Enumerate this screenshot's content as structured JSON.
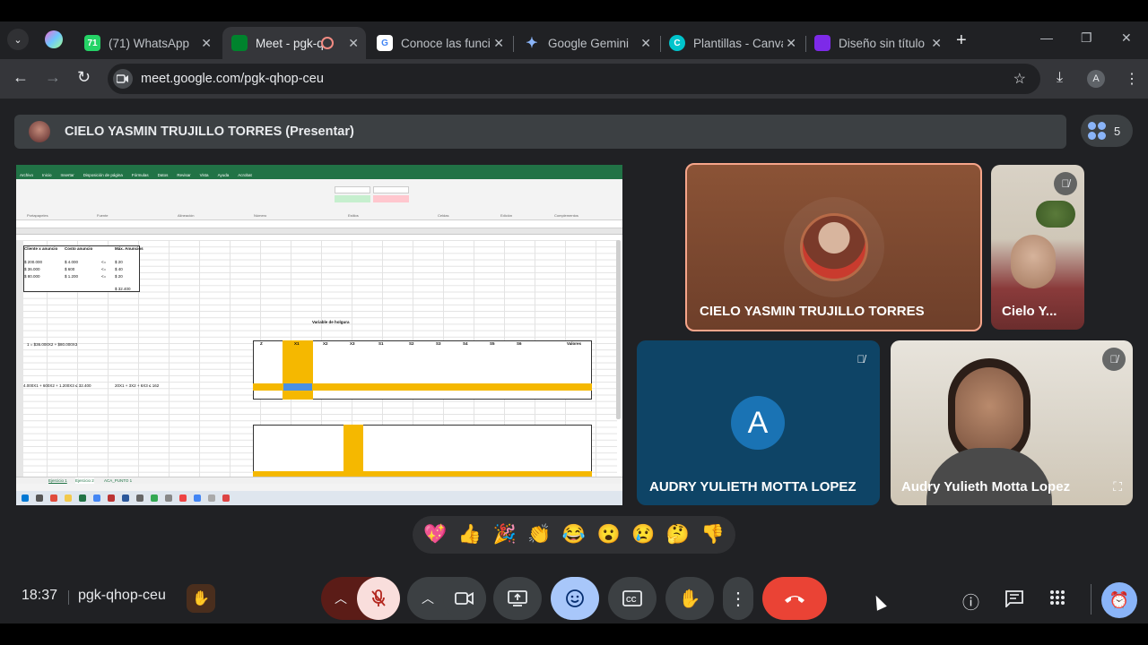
{
  "browser": {
    "tabs": [
      {
        "label": "(71) WhatsApp",
        "badge": "71",
        "fav_color": "#25d366"
      },
      {
        "label": "Meet - pgk-q",
        "fav_color": "#00832d"
      },
      {
        "label": "Conoce las funcio",
        "fav_color": "#ffffff"
      },
      {
        "label": "Google Gemini",
        "fav_color": "#4e8df5"
      },
      {
        "label": "Plantillas - Canva",
        "fav_color": "#00c4cc"
      },
      {
        "label": "Diseño sin título",
        "fav_color": "#7d2ae8"
      }
    ],
    "url": "meet.google.com/pgk-qhop-ceu",
    "profile_initial": "A"
  },
  "meet": {
    "presenter_label": "CIELO YASMIN TRUJILLO TORRES (Presentar)",
    "participant_count": "5",
    "tiles": {
      "cielo_main": "CIELO YASMIN TRUJILLO TORRES",
      "cielo_small": "Cielo Y...",
      "audry_avatar": "AUDRY YULIETH MOTTA LOPEZ",
      "audry_avatar_initial": "A",
      "audry_cam": "Audry Yulieth Motta Lopez"
    },
    "reactions": [
      "💖",
      "👍",
      "🎉",
      "👏",
      "😂",
      "😮",
      "😢",
      "🤔",
      "👎"
    ],
    "clock": "18:37",
    "meeting_code": "pgk-qhop-ceu"
  },
  "excel": {
    "ribbon_tabs": [
      "Archivo",
      "Inicio",
      "Insertar",
      "Disposición de página",
      "Fórmulas",
      "Datos",
      "Revisar",
      "Vista",
      "Ayuda",
      "Acrobat"
    ],
    "ribbon_groups": [
      "Portapapeles",
      "Fuente",
      "Alineación",
      "Número",
      "Estilos",
      "Celdas",
      "Edición",
      "Complementos"
    ],
    "table_headers": [
      "Cliente x anuncio",
      "Costo anuncio",
      "Máx. Anuncios"
    ],
    "table_rows": [
      [
        "$ 200.000",
        "$ 4.000",
        "<=",
        "$ 20"
      ],
      [
        "$ 36.000",
        "$ 600",
        "<=",
        "$ 40"
      ],
      [
        "$ 80.000",
        "$ 1.200",
        "<=",
        "$ 20"
      ]
    ],
    "table_total": "$ 32.400",
    "section_label": "Variable de holgura",
    "objective": "1 = $36.000X2 + $80.000X3",
    "constraint_main": "4.000X1 + 600X2 + 1.200X3 ≤ 32.400",
    "constraint_alt": "20X1 + 3X2 + 6X3 ≤ 162",
    "tableau_cols": [
      "Z",
      "X1",
      "X2",
      "X3",
      "S1",
      "S2",
      "S3",
      "S4",
      "S5",
      "S6",
      "Valores"
    ],
    "sheet_tabs": [
      "Ejercicio 1",
      "Ejercicio 2",
      "ACA_PUNTO 1"
    ]
  }
}
